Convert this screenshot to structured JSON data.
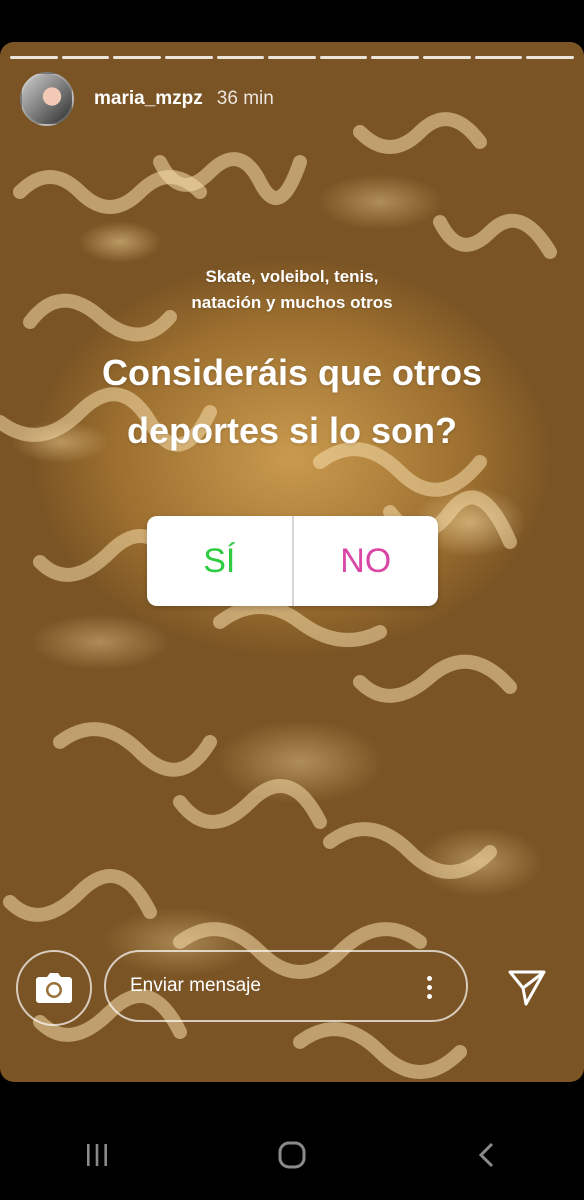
{
  "story": {
    "username": "maria_mzpz",
    "time": "36 min",
    "subtitle_line1": "Skate, voleibol, tenis,",
    "subtitle_line2": "natación y muchos otros",
    "question_line1": "Consideráis que otros",
    "question_line2": "deportes si lo son?",
    "poll": {
      "yes": "SÍ",
      "no": "NO"
    },
    "progress_segments": 11
  },
  "reply": {
    "placeholder": "Enviar mensaje"
  },
  "icons": {
    "camera": "camera-icon",
    "more": "more-vertical-icon",
    "send": "send-icon",
    "recents": "recents-icon",
    "home": "home-icon",
    "back": "back-icon"
  },
  "colors": {
    "yes": "#2ecc40",
    "no": "#d946a6"
  }
}
